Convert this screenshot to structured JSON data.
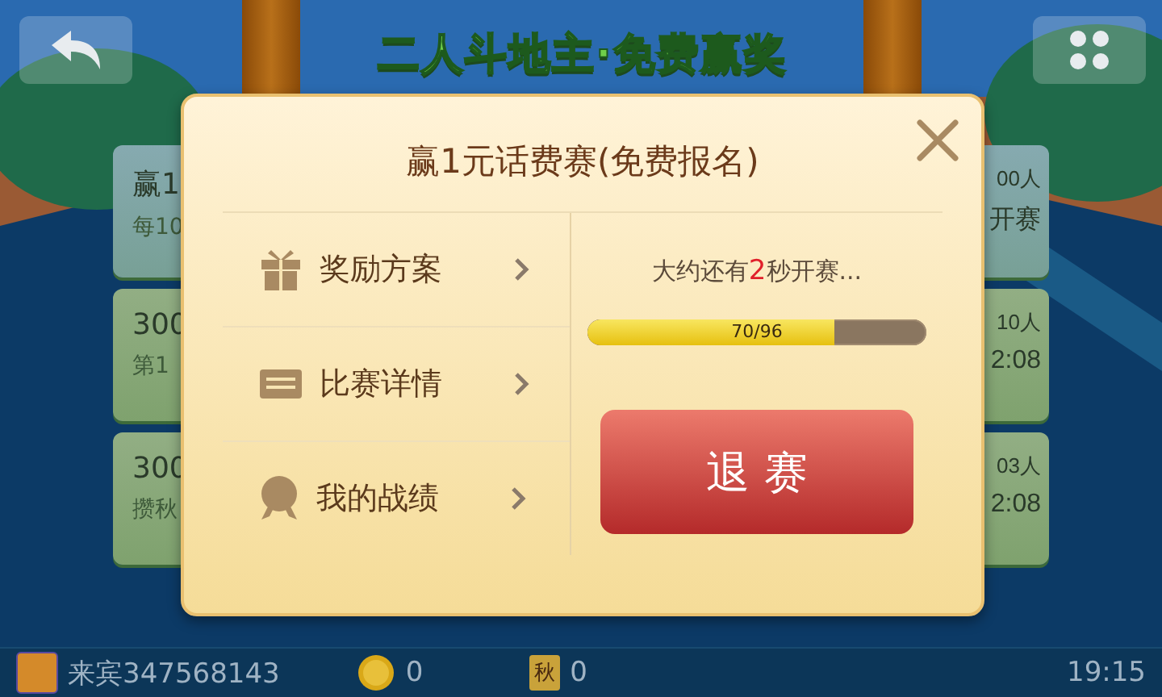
{
  "top_bar": {
    "title": "二人斗地主·免费赢奖"
  },
  "matches": [
    {
      "title": "赢1",
      "subtitle": "每10",
      "players": "00人",
      "status": "开赛",
      "selected": true
    },
    {
      "title": "300",
      "subtitle": "第1",
      "players": "10人",
      "status": "2:08",
      "selected": false
    },
    {
      "title": "300",
      "subtitle": "攒秋",
      "players": "03人",
      "status": "2:08",
      "selected": false
    }
  ],
  "dialog": {
    "title": "赢1元话费赛(免费报名)",
    "menu": [
      {
        "kind": "gift",
        "label": "奖励方案"
      },
      {
        "kind": "ticket",
        "label": "比赛详情"
      },
      {
        "kind": "medal",
        "label": "我的战绩"
      }
    ],
    "countdown": {
      "before": "大约还有",
      "number": "2",
      "after": "秒开赛..."
    },
    "progress": {
      "level": 0.729,
      "label": "70/96"
    },
    "button": "退 赛"
  },
  "status_bar": {
    "user": "来宾347568143",
    "coins": "0",
    "badge": "秋",
    "autumn": "0",
    "time": "19:15"
  }
}
